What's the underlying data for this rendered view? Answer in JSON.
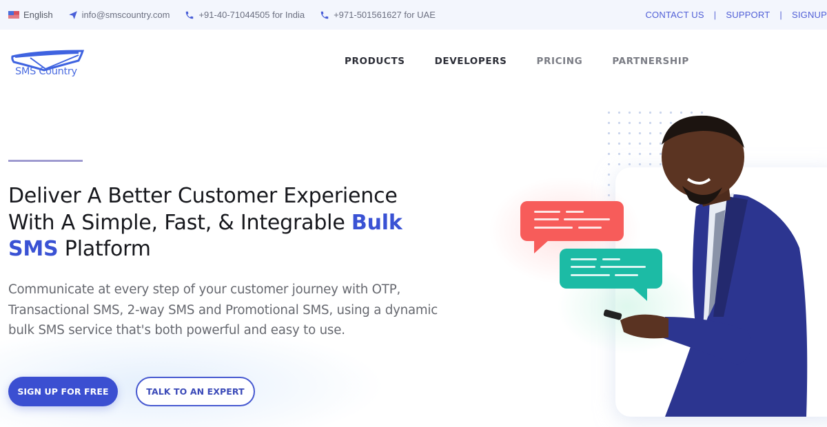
{
  "topbar": {
    "language": "English",
    "email": "info@smscountry.com",
    "phone_india": "+91-40-71044505 for India",
    "phone_uae": "+971-501561627 for UAE",
    "links": [
      "CONTACT US",
      "SUPPORT",
      "SIGNUP"
    ],
    "separator": "|"
  },
  "logo": {
    "text": "SMS Country"
  },
  "nav": {
    "items": [
      "PRODUCTS",
      "DEVELOPERS",
      "PRICING",
      "PARTNERSHIP"
    ]
  },
  "hero": {
    "headline_part1": "Deliver A Better Customer Experience With A Simple, Fast, & Integrable ",
    "headline_highlight": "Bulk SMS",
    "headline_part2": " Platform",
    "description": "Communicate at every step of your customer journey with OTP, Transactional SMS, 2-way SMS and Promotional SMS, using a dynamic bulk SMS service that's both powerful and easy to use.",
    "primary_button": "SIGN UP FOR FREE",
    "secondary_button": "TALK TO AN EXPERT"
  },
  "colors": {
    "brand": "#3b4fd1",
    "topbar_bg": "#f3f6fd",
    "bubble_red": "#f75c5a",
    "bubble_green": "#1cbba5",
    "suit_blue": "#2b3592"
  },
  "illustration": {
    "subject": "smiling man in blue suit using phone",
    "icons": [
      "chat-bubble-red",
      "chat-bubble-green",
      "dot-grid"
    ]
  }
}
